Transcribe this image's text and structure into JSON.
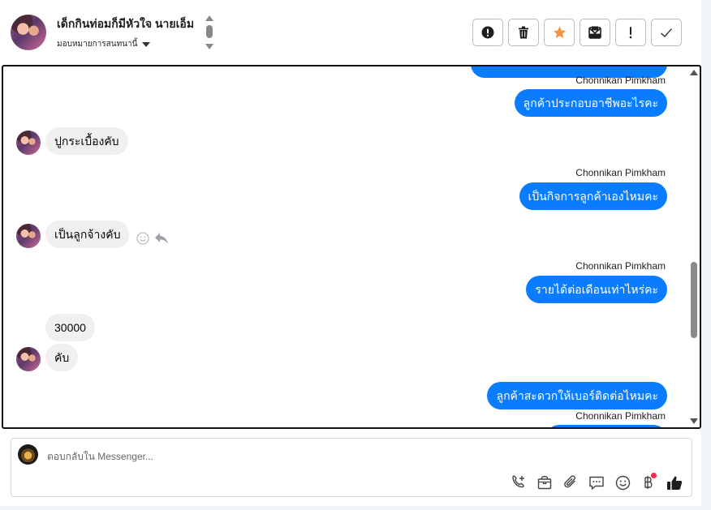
{
  "header": {
    "contact_name": "เด็กกินท่อมก็มีหัวใจ นายเอ็ม",
    "assign_label": "มอบหมายการสนทนานี้",
    "actions": [
      {
        "name": "spam-button",
        "icon": "alert-circle-icon"
      },
      {
        "name": "delete-button",
        "icon": "trash-icon"
      },
      {
        "name": "star-button",
        "icon": "star-icon",
        "color": "#f7923a"
      },
      {
        "name": "archive-button",
        "icon": "mail-archive-icon"
      },
      {
        "name": "follow-up-button",
        "icon": "exclamation-icon"
      },
      {
        "name": "done-button",
        "icon": "checkmark-icon"
      }
    ]
  },
  "conversation": {
    "messages": [
      {
        "from": "page",
        "sender": "Chonnikan Pimkham",
        "text": "ลูกค้าประกอบอาชีพอะไรคะ"
      },
      {
        "from": "customer",
        "text": "ปูกระเบื้องคับ"
      },
      {
        "from": "page",
        "sender": "Chonnikan Pimkham",
        "text": "เป็นกิจการลูกค้าเองไหมคะ"
      },
      {
        "from": "customer",
        "text": "เป็นลูกจ้างคับ"
      },
      {
        "from": "page",
        "sender": "Chonnikan Pimkham",
        "text": "รายได้ต่อเดือนเท่าไหร่คะ"
      },
      {
        "from": "customer",
        "text": "30000"
      },
      {
        "from": "customer",
        "text": "คับ"
      },
      {
        "from": "page",
        "sender": "Chonnikan Pimkham",
        "text": "ลูกค้าสะดวกให้เบอร์ติดต่อไหมคะ"
      },
      {
        "from": "page",
        "sender": "Chonnikan Pimkham",
        "text": ""
      }
    ]
  },
  "composer": {
    "placeholder": "ตอบกลับใน Messenger...",
    "tools": [
      "call-add-icon",
      "shopping-bag-icon",
      "paperclip-icon",
      "chat-bubble-icon",
      "smiley-icon",
      "baht-icon",
      "thumbs-up-icon"
    ]
  },
  "colors": {
    "outgoing_bubble": "#0a7cff",
    "incoming_bubble": "#f0f0f0",
    "notification_dot": "#f02849"
  }
}
